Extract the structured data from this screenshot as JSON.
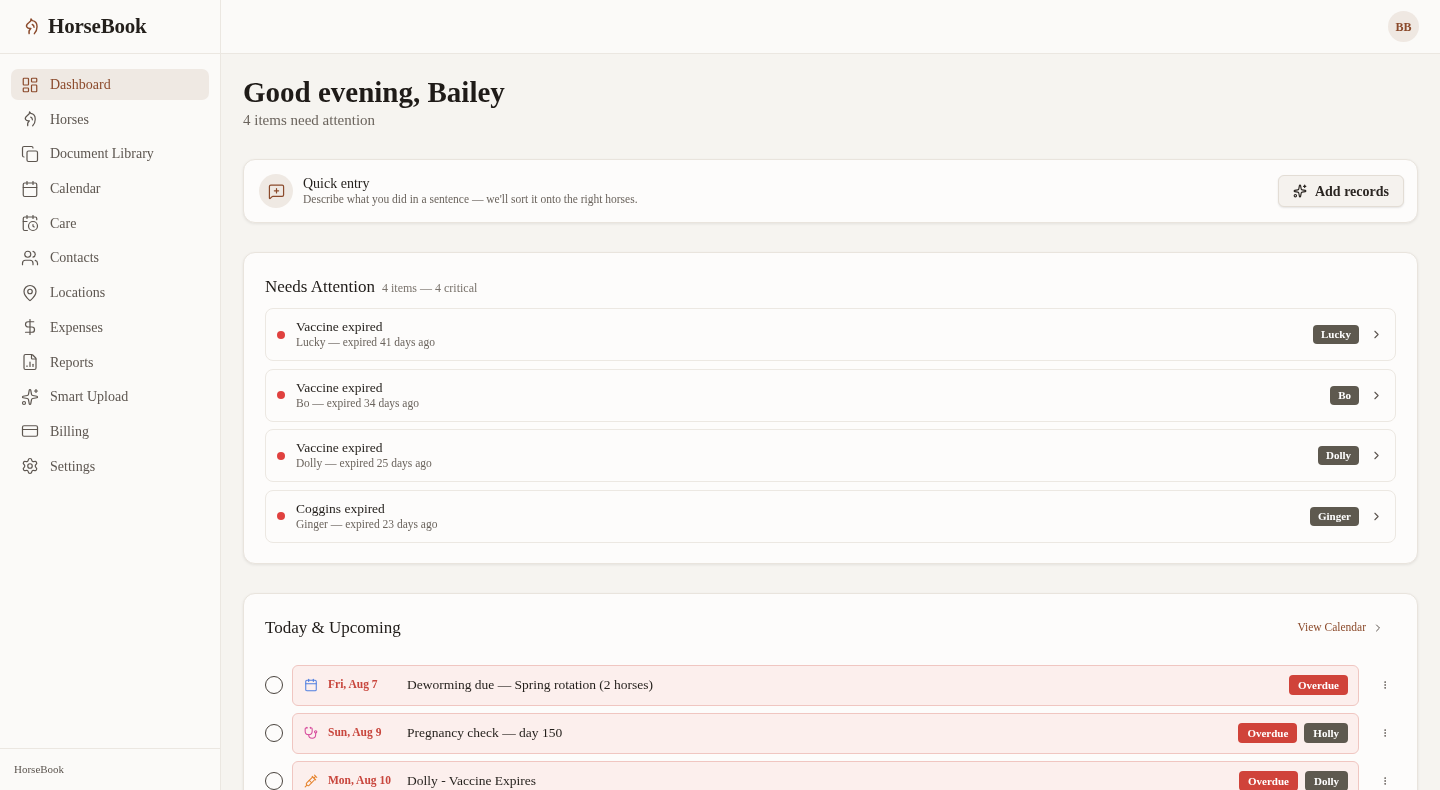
{
  "app": {
    "name": "HorseBook"
  },
  "sidebar": {
    "items": [
      {
        "label": "Dashboard",
        "selected": true
      },
      {
        "label": "Horses",
        "selected": false
      },
      {
        "label": "Document Library",
        "selected": false
      },
      {
        "label": "Calendar",
        "selected": false
      },
      {
        "label": "Care",
        "selected": false
      },
      {
        "label": "Contacts",
        "selected": false
      },
      {
        "label": "Locations",
        "selected": false
      },
      {
        "label": "Expenses",
        "selected": false
      },
      {
        "label": "Reports",
        "selected": false
      },
      {
        "label": "Smart Upload",
        "selected": false
      },
      {
        "label": "Billing",
        "selected": false
      },
      {
        "label": "Settings",
        "selected": false
      }
    ],
    "footer": "HorseBook"
  },
  "top_bar": {
    "avatar": "BB"
  },
  "greeting": {
    "title": "Good evening, Bailey",
    "subtitle": "4 items need attention"
  },
  "quick_entry": {
    "title": "Quick entry",
    "description": "Describe what you did in a sentence — we'll sort it onto the right horses.",
    "button": "Add records"
  },
  "needs_attention": {
    "title": "Needs Attention",
    "summary": "4 items — 4 critical",
    "items": [
      {
        "title": "Vaccine expired",
        "detail": "Lucky — expired 41 days ago",
        "horse": "Lucky",
        "color": "#e0413f"
      },
      {
        "title": "Vaccine expired",
        "detail": "Bo — expired 34 days ago",
        "horse": "Bo",
        "color": "#e0413f"
      },
      {
        "title": "Vaccine expired",
        "detail": "Dolly — expired 25 days ago",
        "horse": "Dolly",
        "color": "#e0413f"
      },
      {
        "title": "Coggins expired",
        "detail": "Ginger — expired 23 days ago",
        "horse": "Ginger",
        "color": "#e0413f"
      }
    ]
  },
  "upcoming": {
    "title": "Today & Upcoming",
    "link": "View Calendar",
    "items": [
      {
        "kind": "event",
        "checked": false,
        "overdue": true,
        "date": "Fri, Aug 7",
        "title": "Deworming due — Spring rotation (2 horses)",
        "tags": [
          {
            "kind": "status",
            "label": "Overdue"
          }
        ]
      },
      {
        "kind": "vet",
        "checked": false,
        "overdue": true,
        "date": "Sun, Aug 9",
        "title": "Pregnancy check — day 150",
        "tags": [
          {
            "kind": "status",
            "label": "Overdue"
          },
          {
            "kind": "horse",
            "label": "Holly"
          }
        ]
      },
      {
        "kind": "vaccine",
        "checked": false,
        "overdue": true,
        "date": "Mon, Aug 10",
        "title": "Dolly - Vaccine Expires",
        "tags": [
          {
            "kind": "status",
            "label": "Overdue"
          },
          {
            "kind": "horse",
            "label": "Dolly"
          }
        ]
      }
    ]
  }
}
